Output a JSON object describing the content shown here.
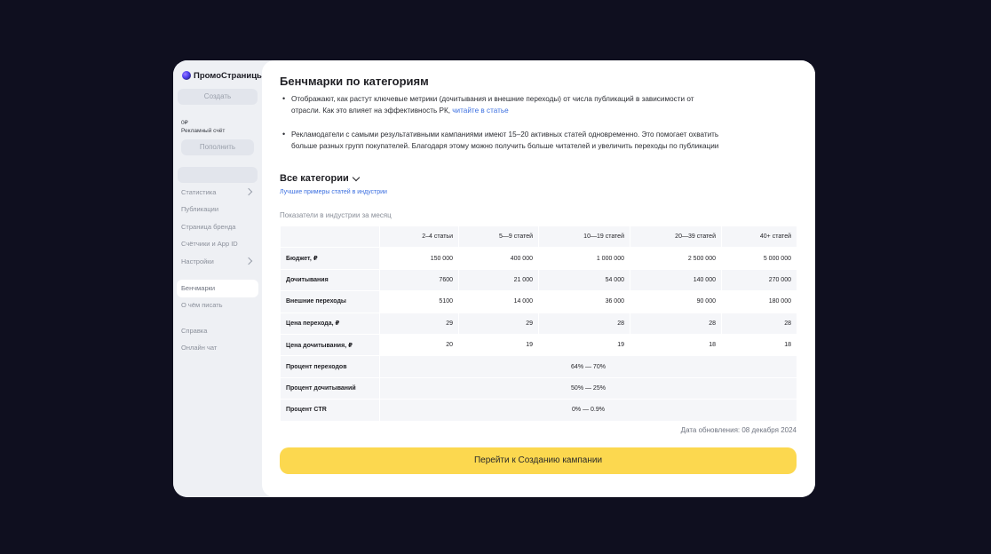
{
  "app": {
    "logo_text": "ПромоСтраницы"
  },
  "sidebar": {
    "create_label": "Создать",
    "balance": "0₽",
    "account_label": "Рекламный счёт",
    "topup_label": "Пополнить",
    "nav": [
      {
        "label": "Статистика",
        "has_chevron": true
      },
      {
        "label": "Публикации"
      },
      {
        "label": "Страница бренда"
      },
      {
        "label": "Счётчики и App ID"
      },
      {
        "label": "Настройки",
        "has_chevron": true
      }
    ],
    "nav2": [
      {
        "label": "Бенчмарки",
        "active": true
      },
      {
        "label": "О чём писать"
      }
    ],
    "nav3": [
      {
        "label": "Справка"
      },
      {
        "label": "Онлайн чат"
      }
    ]
  },
  "main": {
    "title": "Бенчмарки по категориям",
    "bullet1_text": "Отображают, как растут ключевые метрики (дочитывания и внешние переходы) от числа публикаций в зависимости от отрасли. Как это влияет на эффективность РК, ",
    "bullet1_link": "читайте в статье",
    "bullet2_text": "Рекламодатели с самыми результативными кампаниями имеют 15–20 активных статей одновременно. Это помогает охватить больше разных групп покупателей. Благодаря этому можно получить больше читателей и увеличить переходы по публикации",
    "category_select": "Все категории",
    "examples_link": "Лучшие примеры статей в индустрии",
    "table_caption": "Показатели в индустрии за месяц",
    "columns": [
      "2–4 статьи",
      "5—9 статей",
      "10—19 статей",
      "20—39 статей",
      "40+ статей"
    ],
    "rows": [
      {
        "label": "Бюджет, ₽",
        "values": [
          "150 000",
          "400 000",
          "1 000 000",
          "2 500 000",
          "5 000 000"
        ]
      },
      {
        "label": "Дочитывания",
        "values": [
          "7600",
          "21 000",
          "54 000",
          "140 000",
          "270 000"
        ]
      },
      {
        "label": "Внешние переходы",
        "values": [
          "5100",
          "14 000",
          "36 000",
          "90 000",
          "180 000"
        ]
      },
      {
        "label": "Цена перехода, ₽",
        "values": [
          "29",
          "29",
          "28",
          "28",
          "28"
        ]
      },
      {
        "label": "Цена дочитывания, ₽",
        "values": [
          "20",
          "19",
          "19",
          "18",
          "18"
        ]
      }
    ],
    "merged_rows": [
      {
        "label": "Процент переходов",
        "value": "64% — 70%"
      },
      {
        "label": "Процент дочитываний",
        "value": "50% — 25%"
      },
      {
        "label": "Процент CTR",
        "value": "0% — 0.9%"
      }
    ],
    "update_date": "Дата обновления: 08 декабря 2024",
    "cta_label": "Перейти к Созданию кампании"
  }
}
